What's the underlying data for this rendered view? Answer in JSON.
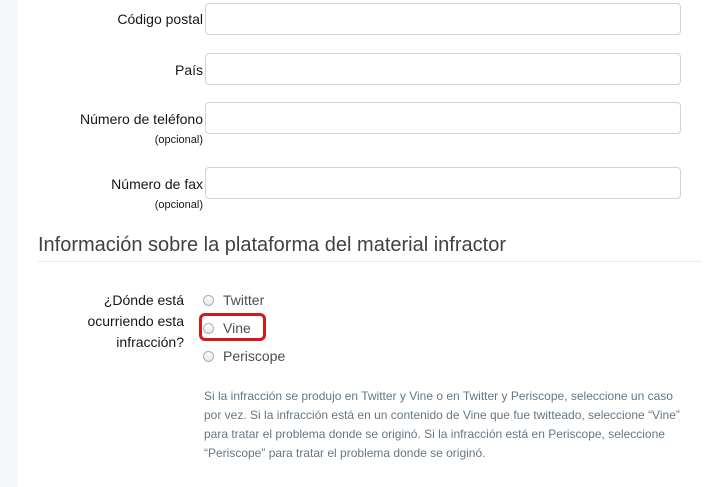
{
  "form": {
    "postal_code": {
      "label": "Código postal",
      "value": ""
    },
    "country": {
      "label": "País",
      "value": ""
    },
    "phone": {
      "label": "Número de teléfono",
      "optional": "(opcional)",
      "value": ""
    },
    "fax": {
      "label": "Número de fax",
      "optional": "(opcional)",
      "value": ""
    }
  },
  "platform_section": {
    "title": "Información sobre la plataforma del material infractor",
    "question": "¿Dónde está ocurriendo esta infracción?",
    "options": [
      {
        "label": "Twitter",
        "selected": false
      },
      {
        "label": "Vine",
        "selected": false,
        "highlighted": true
      },
      {
        "label": "Periscope",
        "selected": false
      }
    ],
    "help_text": "Si la infracción se produjo en Twitter y Vine o en Twitter y Periscope, seleccione un caso por vez. Si la infracción está en un contenido de Vine que fue twitteado, seleccione “Vine” para tratar el problema donde se originó. Si la infracción está en Periscope, seleccione “Periscope” para tratar el problema donde se originó."
  },
  "colors": {
    "highlight": "#d4171d",
    "field_border": "#cdd5da",
    "help_text": "#657786"
  }
}
